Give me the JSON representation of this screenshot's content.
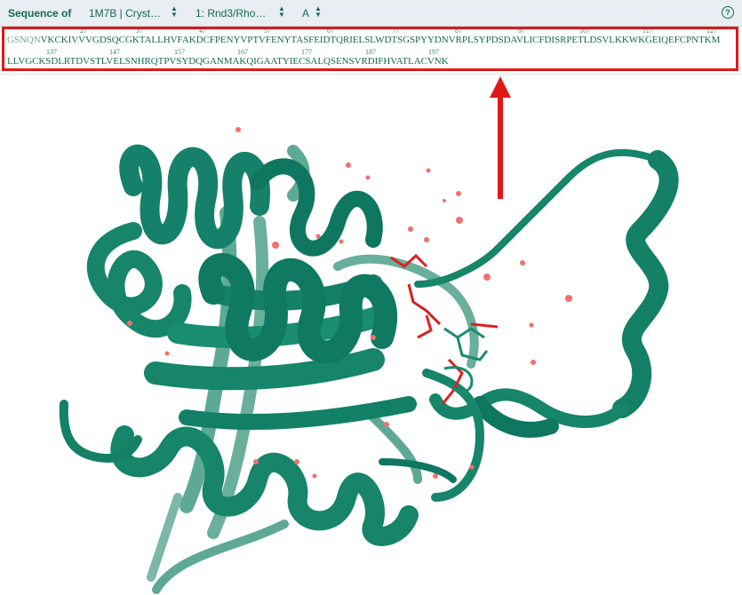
{
  "toolbar": {
    "title": "Sequence of",
    "structure_select": "1M7B | Cryst…",
    "entity_select": "1: Rnd3/Rho…",
    "chain_select": "A",
    "help_icon": "?"
  },
  "sequence": {
    "line1_dim": "GSNQN",
    "line1_main": "VKCKIVVVGDSQCGKTALLHVFAKDCFPENYVPTVFENYTASFEIDTQRIELSLWDTSGSPYYDNVRPLSYPDSDAVLICFDISRPETLDSVLKKWKGEIQEFCPNTKM",
    "line2_main": "LLVGCKSDLRTDVSTLVELSNHRQTPVSYDQGANMAKQIGAATYIECSALQSENSVRDIFHVATLACVNK",
    "line1_numbers": [
      "27",
      "37",
      "47",
      "57",
      "67",
      "77",
      "87",
      "97",
      "107",
      "117",
      "127"
    ],
    "line2_numbers": [
      "137",
      "147",
      "157",
      "167",
      "177",
      "187",
      "197"
    ]
  },
  "colors": {
    "protein": "#16856a",
    "protein_dark": "#0f6d55",
    "protein_light": "#5ea996",
    "ligand": "#e02020",
    "water": "#f07070",
    "highlight": "#e01818"
  }
}
